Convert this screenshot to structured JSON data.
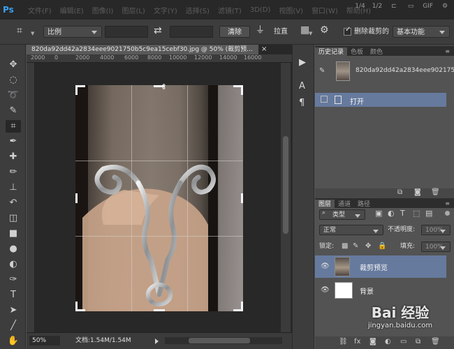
{
  "app": {
    "logo": "Ps"
  },
  "menu": [
    "文件(F)",
    "编辑(E)",
    "图像(I)",
    "图层(L)",
    "文字(Y)",
    "选择(S)",
    "滤镜(T)",
    "3D(D)",
    "视图(V)",
    "窗口(W)",
    "帮助(H)"
  ],
  "view_buttons": [
    "1/4",
    "1/2",
    "GIF"
  ],
  "options": {
    "ratio_label": "比例",
    "clear_label": "清除",
    "straighten_label": "拉直",
    "delete_cropped_label": "删除裁剪的",
    "workspace_label": "基本功能"
  },
  "document": {
    "tab_title": "820da92dd42a2834eee9021750b5c9ea15cebf30.jpg @ 50% (裁剪预...",
    "zoom": "50%",
    "doc_info": "文档:1.54M/1.54M"
  },
  "ruler": {
    "ticks": [
      "2000",
      "0",
      "2000",
      "4000",
      "6000",
      "8000",
      "10000",
      "12000",
      "14000",
      "16000"
    ]
  },
  "history": {
    "tabs": [
      "历史记录",
      "色板",
      "颜色"
    ],
    "snapshot_name": "820da92dd42a2834eee902175...",
    "states": [
      "打开"
    ]
  },
  "layers": {
    "tabs": [
      "图层",
      "通道",
      "路径"
    ],
    "filter_label": "类型",
    "blend_mode": "正常",
    "opacity_label": "不透明度:",
    "opacity_value": "100%",
    "lock_label": "锁定:",
    "fill_label": "填充:",
    "fill_value": "100%",
    "items": [
      {
        "name": "裁剪预览",
        "selected": true
      },
      {
        "name": "背景",
        "selected": false
      }
    ]
  },
  "watermark": {
    "brand": "Bai 经验",
    "url": "jingyan.baidu.com"
  },
  "colors": {
    "accent": "#667a9e",
    "chrome_dark": "#282828",
    "panel": "#535353"
  }
}
